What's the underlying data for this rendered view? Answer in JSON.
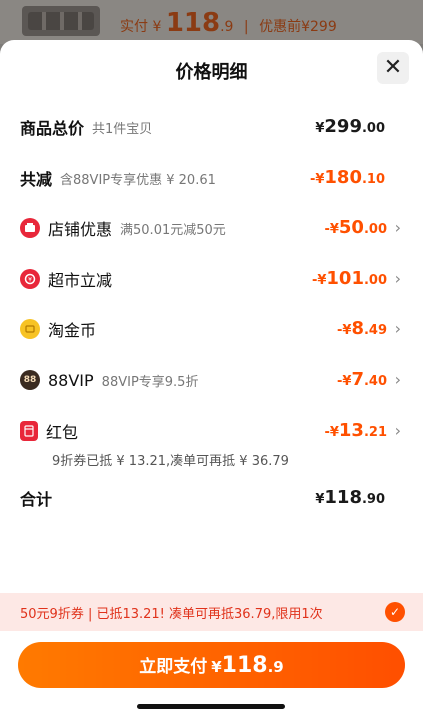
{
  "background": {
    "pay_label": "实付",
    "pay_currency": "¥",
    "pay_amount_int": "118",
    "pay_amount_dec": ".9",
    "separator": "|",
    "original_label": "优惠前",
    "original_currency": "¥",
    "original_amount": "299"
  },
  "sheet": {
    "title": "价格明细",
    "close_icon": "close-icon",
    "rows": {
      "total": {
        "label": "商品总价",
        "sub": "共1件宝贝",
        "currency": "¥",
        "int": "299",
        "dec": ".00"
      },
      "reduction": {
        "label": "共减",
        "sub": "含88VIP专享优惠 ¥ 20.61",
        "currency": "-¥",
        "int": "180",
        "dec": ".10"
      },
      "store": {
        "label": "店铺优惠",
        "sub": "满50.01元减50元",
        "currency": "-¥",
        "int": "50",
        "dec": ".00",
        "icon": "store-coupon-icon"
      },
      "market": {
        "label": "超市立减",
        "sub": "",
        "currency": "-¥",
        "int": "101",
        "dec": ".00",
        "icon": "supermarket-discount-icon"
      },
      "coin": {
        "label": "淘金币",
        "sub": "",
        "currency": "-¥",
        "int": "8",
        "dec": ".49",
        "icon": "gold-coin-icon"
      },
      "vip": {
        "label": "88VIP",
        "sub": "88VIP专享9.5折",
        "currency": "-¥",
        "int": "7",
        "dec": ".40",
        "icon": "88vip-icon",
        "icon_text": "88"
      },
      "redpacket": {
        "label": "红包",
        "sub": "",
        "currency": "-¥",
        "int": "13",
        "dec": ".21",
        "icon": "red-packet-icon",
        "note": "9折券已抵 ¥ 13.21,凑单可再抵 ¥ 36.79"
      },
      "sum": {
        "label": "合计",
        "currency": "¥",
        "int": "118",
        "dec": ".90"
      }
    }
  },
  "promo": {
    "text": "50元9折券 | 已抵13.21! 凑单可再抵36.79,限用1次",
    "checked": true
  },
  "pay_button": {
    "label": "立即支付",
    "currency": "¥",
    "int": "118",
    "dec": ".9"
  },
  "colors": {
    "accent": "#ff5000",
    "promo_bg": "#fde8e5",
    "store_icon": "#e8273a",
    "coin_icon": "#f7c325",
    "vip_icon": "#3a2b20"
  }
}
